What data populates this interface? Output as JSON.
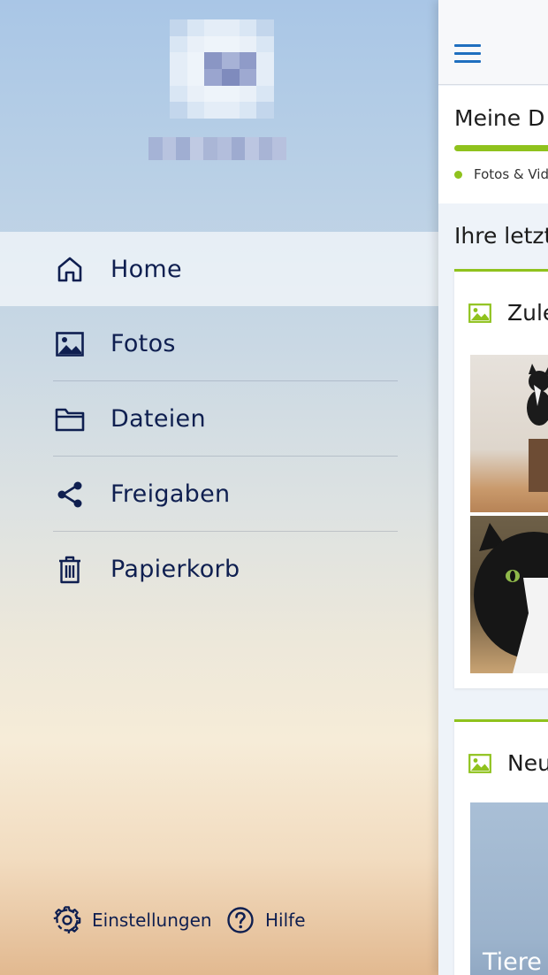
{
  "drawer": {
    "nav": [
      {
        "label": "Home",
        "icon": "home-icon",
        "active": true
      },
      {
        "label": "Fotos",
        "icon": "image-icon",
        "active": false
      },
      {
        "label": "Dateien",
        "icon": "folder-icon",
        "active": false
      },
      {
        "label": "Freigaben",
        "icon": "share-icon",
        "active": false
      },
      {
        "label": "Papierkorb",
        "icon": "trash-icon",
        "active": false
      }
    ],
    "footer": {
      "settings_label": "Einstellungen",
      "help_label": "Hilfe"
    }
  },
  "main": {
    "storage_title": "Meine D",
    "storage_legend": "Fotos & Vide",
    "recent_title": "Ihre letzt",
    "cards": [
      {
        "title": "Zule",
        "icon": "image-icon"
      },
      {
        "title": "Neu",
        "icon": "image-icon",
        "photo_tag": "Tiere"
      }
    ]
  },
  "colors": {
    "accent_green": "#8fc21d",
    "nav_text": "#0f1f50",
    "menu_blue": "#1f6fbf"
  }
}
